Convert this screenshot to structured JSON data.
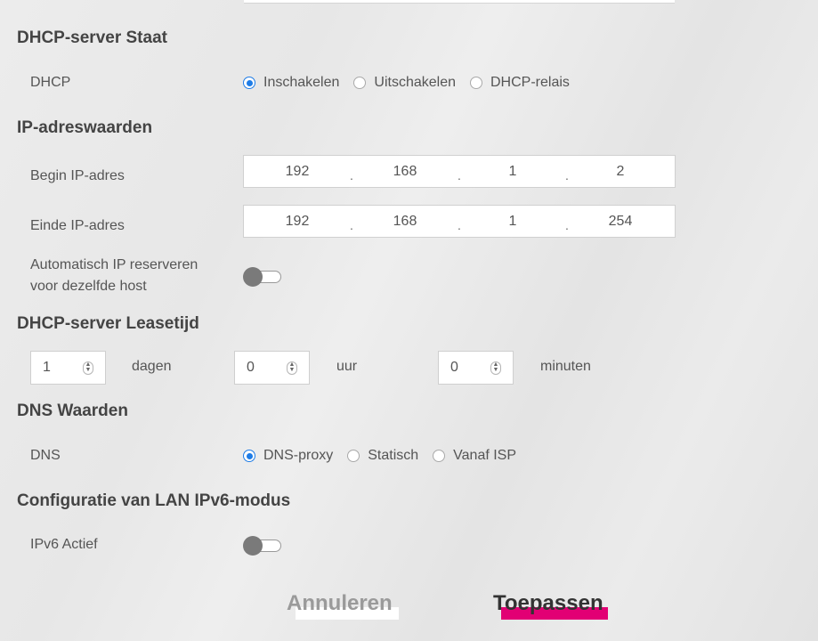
{
  "sections": {
    "dhcp_state": {
      "title": "DHCP-server Staat",
      "label": "DHCP",
      "options": [
        "Inschakelen",
        "Uitschakelen",
        "DHCP-relais"
      ],
      "selected": "Inschakelen"
    },
    "ip_values": {
      "title": "IP-adreswaarden",
      "start_label": "Begin IP-adres",
      "start": [
        "192",
        "168",
        "1",
        "2"
      ],
      "end_label": "Einde IP-adres",
      "end": [
        "192",
        "168",
        "1",
        "254"
      ],
      "reserve_label_line1": "Automatisch IP reserveren",
      "reserve_label_line2": "voor dezelfde host",
      "reserve_enabled": false
    },
    "lease": {
      "title": "DHCP-server Leasetijd",
      "days_value": "1",
      "days_unit": "dagen",
      "hours_value": "0",
      "hours_unit": "uur",
      "minutes_value": "0",
      "minutes_unit": "minuten"
    },
    "dns": {
      "title": "DNS Waarden",
      "label": "DNS",
      "options": [
        "DNS-proxy",
        "Statisch",
        "Vanaf ISP"
      ],
      "selected": "DNS-proxy"
    },
    "ipv6": {
      "title": "Configuratie van LAN IPv6-modus",
      "label": "IPv6 Actief",
      "enabled": false
    }
  },
  "buttons": {
    "cancel": "Annuleren",
    "apply": "Toepassen"
  },
  "colors": {
    "accent": "#e20074",
    "radio_selected": "#1e7ce6"
  }
}
